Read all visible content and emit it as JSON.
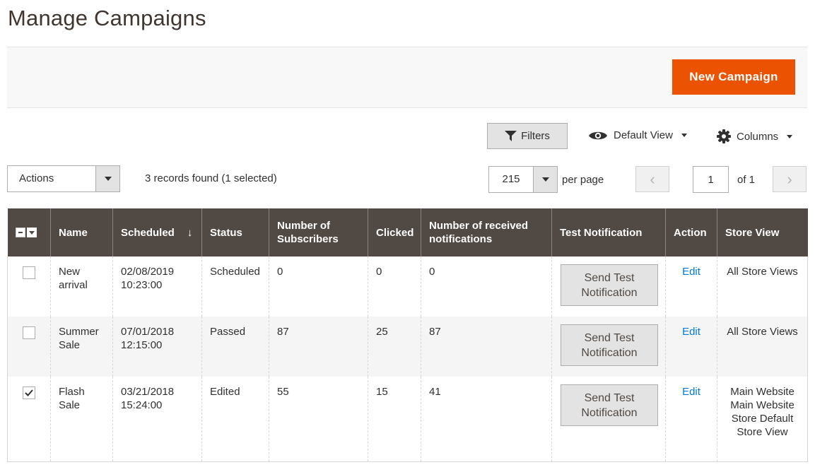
{
  "page": {
    "title": "Manage Campaigns"
  },
  "action_bar": {
    "new_button": "New Campaign",
    "accent": "#eb5202"
  },
  "toolbar": {
    "filters": "Filters",
    "view": "Default View",
    "columns": "Columns"
  },
  "grid_controls": {
    "actions_label": "Actions",
    "records_text": "3 records found (1 selected)",
    "per_page_value": "215",
    "per_page_label": "per page",
    "current_page": "1",
    "page_of": "of 1",
    "prev_glyph": "‹",
    "next_glyph": "›"
  },
  "grid": {
    "header_color": "#514943",
    "columns": [
      "Name",
      "Scheduled",
      "Status",
      "Number of Subscribers",
      "Clicked",
      "Number of received notifications",
      "Test Notification",
      "Action",
      "Store View"
    ],
    "sort_glyph": "↓",
    "rows": [
      {
        "checked": false,
        "name": "New arrival",
        "scheduled": "02/08/2019 10:23:00",
        "status": "Scheduled",
        "subscribers": "0",
        "clicked": "0",
        "received": "0",
        "test_button": "Send Test Notification",
        "action": "Edit",
        "store_view": "All Store Views"
      },
      {
        "checked": false,
        "name": "Summer Sale",
        "scheduled": "07/01/2018 12:15:00",
        "status": "Passed",
        "subscribers": "87",
        "clicked": "25",
        "received": "87",
        "test_button": "Send Test Notification",
        "action": "Edit",
        "store_view": "All Store Views"
      },
      {
        "checked": true,
        "name": "Flash Sale",
        "scheduled": "03/21/2018 15:24:00",
        "status": "Edited",
        "subscribers": "55",
        "clicked": "15",
        "received": "41",
        "test_button": "Send Test Notification",
        "action": "Edit",
        "store_view": "Main Website Main Website Store Default Store View"
      }
    ]
  }
}
